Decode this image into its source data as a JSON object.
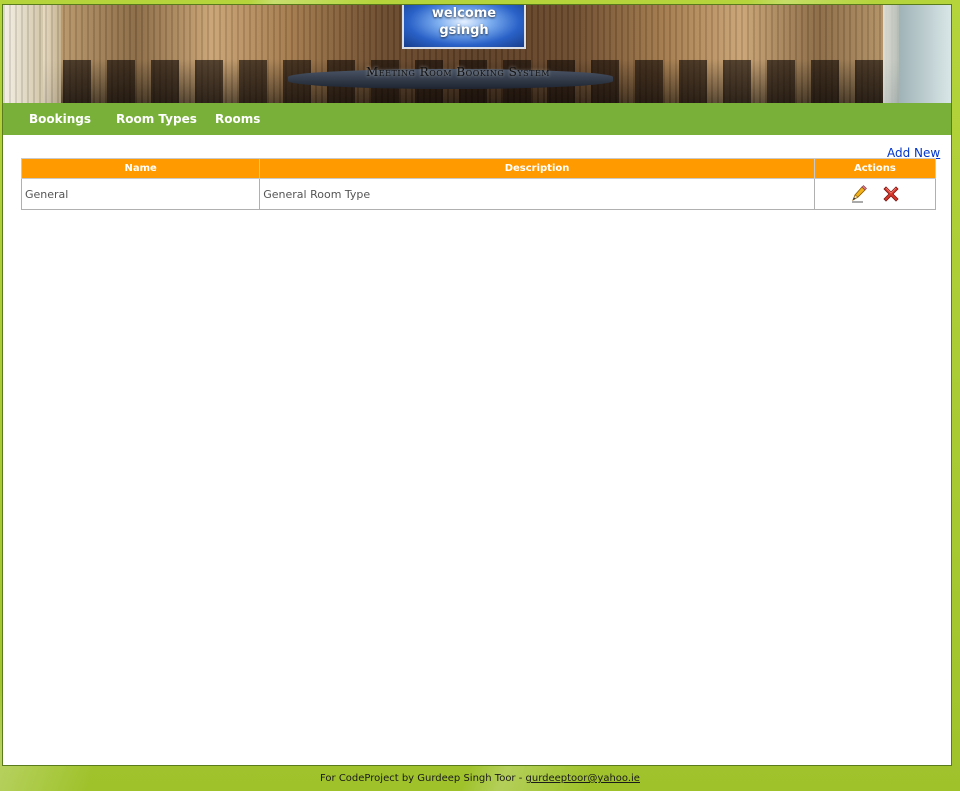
{
  "header": {
    "welcome_label": "welcome",
    "username": "gsingh",
    "system_title": "Meeting Room Booking System"
  },
  "nav": {
    "items": [
      {
        "label": "Bookings"
      },
      {
        "label": "Room Types"
      },
      {
        "label": "Rooms"
      }
    ]
  },
  "main": {
    "add_new_label": "Add New",
    "table": {
      "columns": [
        "Name",
        "Description",
        "Actions"
      ],
      "rows": [
        {
          "name": "General",
          "description": "General Room Type",
          "actions": [
            "edit-icon",
            "delete-icon"
          ]
        }
      ]
    }
  },
  "footer": {
    "text": "For CodeProject by Gurdeep Singh Toor - ",
    "email": "gurdeeptoor@yahoo.ie"
  },
  "colors": {
    "page_bg": "#a8c832",
    "nav_bg": "#79b03a",
    "table_header_bg": "#ff9a00",
    "link": "#0033cc"
  }
}
